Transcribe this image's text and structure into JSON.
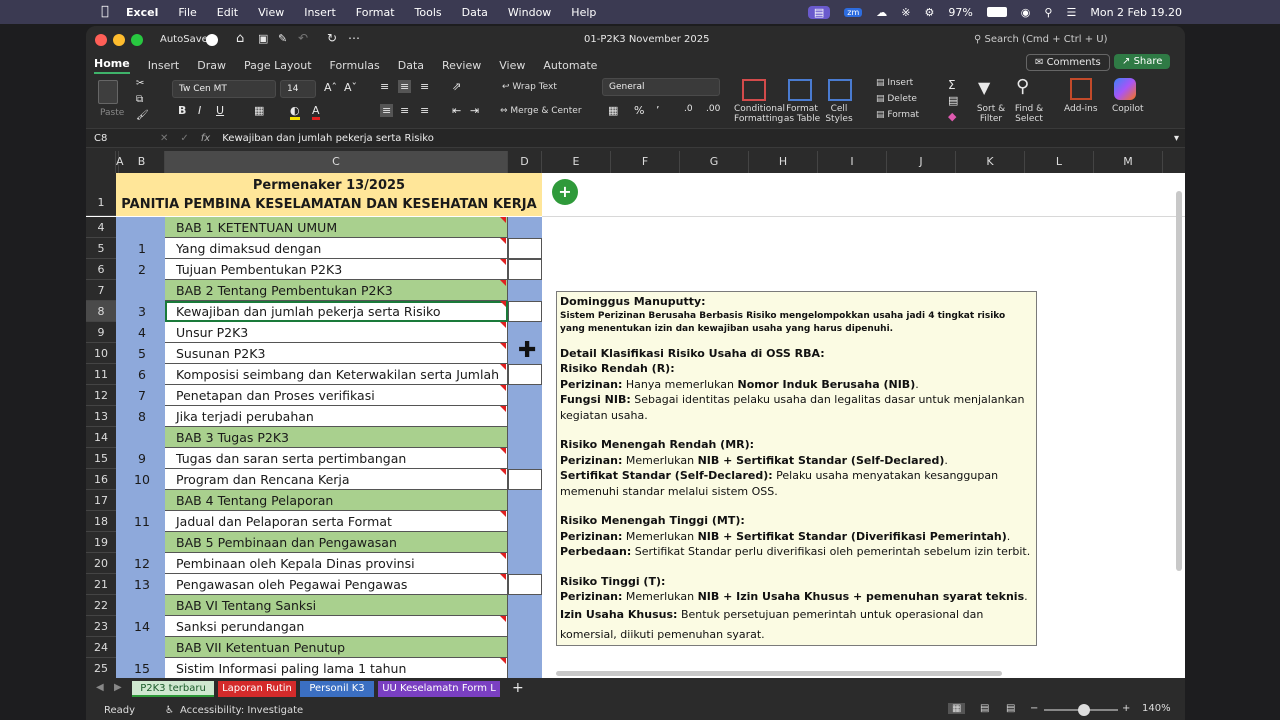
{
  "menubar": {
    "apple": "",
    "app": "Excel",
    "items": [
      "File",
      "Edit",
      "View",
      "Insert",
      "Format",
      "Tools",
      "Data",
      "Window",
      "Help"
    ],
    "battery": "97%",
    "datetime": "Mon 2 Feb  19.20"
  },
  "title": {
    "autosave": "AutoSave",
    "filename": "01-P2K3 November 2025",
    "search": "Search (Cmd + Ctrl + U)"
  },
  "ribbon_tabs": [
    "Home",
    "Insert",
    "Draw",
    "Page Layout",
    "Formulas",
    "Data",
    "Review",
    "View",
    "Automate"
  ],
  "ribbon": {
    "comments": "Comments",
    "share": "Share",
    "paste": "Paste",
    "font": "Tw Cen MT",
    "size": "14",
    "wrap": "Wrap Text",
    "merge": "Merge & Center",
    "numfmt": "General",
    "cond": "Conditional Formatting",
    "fmt_table": "Format as Table",
    "cell_styles": "Cell Styles",
    "insert": "Insert",
    "delete": "Delete",
    "format": "Format",
    "sort": "Sort & Filter",
    "find": "Find & Select",
    "addins": "Add-ins",
    "copilot": "Copilot"
  },
  "formula": {
    "cellref": "C8",
    "fx": "fx",
    "content": "Kewajiban dan jumlah pekerja serta Risiko"
  },
  "columns": [
    "A",
    "B",
    "C",
    "D",
    "E",
    "F",
    "G",
    "H",
    "I",
    "J",
    "K",
    "L",
    "M"
  ],
  "header_rows": {
    "r1_line1": "Permenaker 13/2025",
    "r1_line2": "PANITIA PEMBINA KESELAMATAN DAN KESEHATAN KERJA"
  },
  "rows": [
    {
      "rn": "4",
      "b": "",
      "c": "BAB 1 KETENTUAN UMUM",
      "bab": true
    },
    {
      "rn": "5",
      "b": "1",
      "c": "Yang dimaksud dengan",
      "bab": false
    },
    {
      "rn": "6",
      "b": "2",
      "c": "Tujuan Pembentukan P2K3",
      "bab": false
    },
    {
      "rn": "7",
      "b": "",
      "c": "BAB 2 Tentang Pembentukan P2K3",
      "bab": true
    },
    {
      "rn": "8",
      "b": "3",
      "c": "Kewajiban dan jumlah pekerja serta Risiko",
      "bab": false
    },
    {
      "rn": "9",
      "b": "4",
      "c": "Unsur P2K3",
      "bab": false
    },
    {
      "rn": "10",
      "b": "5",
      "c": "Susunan P2K3",
      "bab": false
    },
    {
      "rn": "11",
      "b": "6",
      "c": "Komposisi seimbang dan Keterwakilan serta Jumlah",
      "bab": false
    },
    {
      "rn": "12",
      "b": "7",
      "c": "Penetapan dan Proses verifikasi",
      "bab": false
    },
    {
      "rn": "13",
      "b": "8",
      "c": "Jika terjadi perubahan",
      "bab": false
    },
    {
      "rn": "14",
      "b": "",
      "c": "BAB 3 Tugas P2K3",
      "bab": true
    },
    {
      "rn": "15",
      "b": "9",
      "c": "Tugas dan saran serta pertimbangan",
      "bab": false
    },
    {
      "rn": "16",
      "b": "10",
      "c": "Program dan Rencana Kerja",
      "bab": false
    },
    {
      "rn": "17",
      "b": "",
      "c": "BAB 4 Tentang Pelaporan",
      "bab": true
    },
    {
      "rn": "18",
      "b": "11",
      "c": "Jadual dan Pelaporan serta Format",
      "bab": false
    },
    {
      "rn": "19",
      "b": "",
      "c": "BAB 5 Pembinaan dan Pengawasan",
      "bab": true
    },
    {
      "rn": "20",
      "b": "12",
      "c": "Pembinaan oleh Kepala Dinas provinsi",
      "bab": false
    },
    {
      "rn": "21",
      "b": "13",
      "c": "Pengawasan oleh Pegawai Pengawas",
      "bab": false
    },
    {
      "rn": "22",
      "b": "",
      "c": "BAB VI Tentang Sanksi",
      "bab": true
    },
    {
      "rn": "23",
      "b": "14",
      "c": "Sanksi perundangan",
      "bab": false
    },
    {
      "rn": "24",
      "b": "",
      "c": "BAB VII Ketentuan Penutup",
      "bab": true
    },
    {
      "rn": "25",
      "b": "15",
      "c": "Sistim Informasi paling lama 1 tahun",
      "bab": false
    }
  ],
  "note": {
    "author": "Dominggus Manuputty:",
    "intro": "Sistem Perizinan Berusaha Berbasis Risiko mengelompokkan usaha jadi 4 tingkat risiko yang menentukan izin dan kewajiban usaha yang harus dipenuhi.",
    "heading": "Detail Klasifikasi Risiko Usaha di OSS RBA:",
    "r_title": "Risiko Rendah (R):",
    "r_perizinan_label": "Perizinan:",
    "r_perizinan_pre": "Hanya memerlukan ",
    "r_perizinan_bold": "Nomor Induk Berusaha (NIB)",
    "r_perizinan_post": ".",
    "r_fungsi_label": "Fungsi NIB:",
    "r_fungsi_text": "Sebagai identitas pelaku usaha dan legalitas dasar untuk menjalankan kegiatan usaha.",
    "mr_title": "Risiko Menengah Rendah (MR):",
    "mr_perizinan_label": "Perizinan:",
    "mr_perizinan_pre": "Memerlukan ",
    "mr_perizinan_bold": "NIB + Sertifikat Standar (Self-Declared)",
    "mr_perizinan_post": ".",
    "mr_sert_label": "Sertifikat Standar (Self-Declared):",
    "mr_sert_text": "Pelaku usaha menyatakan kesanggupan memenuhi standar melalui sistem OSS.",
    "mt_title": "Risiko Menengah Tinggi (MT):",
    "mt_perizinan_label": "Perizinan:",
    "mt_perizinan_pre": "Memerlukan ",
    "mt_perizinan_bold": "NIB + Sertifikat Standar (Diverifikasi Pemerintah)",
    "mt_perizinan_post": ".",
    "mt_beda_label": "Perbedaan:",
    "mt_beda_text": "Sertifikat Standar perlu diverifikasi oleh pemerintah sebelum izin terbit.",
    "t_title": "Risiko Tinggi (T):",
    "t_perizinan_label": "Perizinan:",
    "t_perizinan_pre": "Memerlukan ",
    "t_perizinan_bold": "NIB + Izin Usaha Khusus + pemenuhan syarat teknis",
    "t_perizinan_post": ".",
    "t_izin_label": "Izin Usaha Khusus:",
    "t_izin_text": "Bentuk persetujuan pemerintah untuk operasional dan komersial, diikuti pemenuhan syarat."
  },
  "sheet_tabs": [
    {
      "label": "P2K3 terbaru",
      "color": "#5aa36c"
    },
    {
      "label": "Laporan Rutin",
      "color": "#d42b2b"
    },
    {
      "label": "Personil K3",
      "color": "#3b6fc2"
    },
    {
      "label": "UU Keselamatn Form L",
      "color": "#7a3fc2"
    }
  ],
  "status": {
    "ready": "Ready",
    "accessibility": "Accessibility: Investigate",
    "zoom": "140%"
  }
}
